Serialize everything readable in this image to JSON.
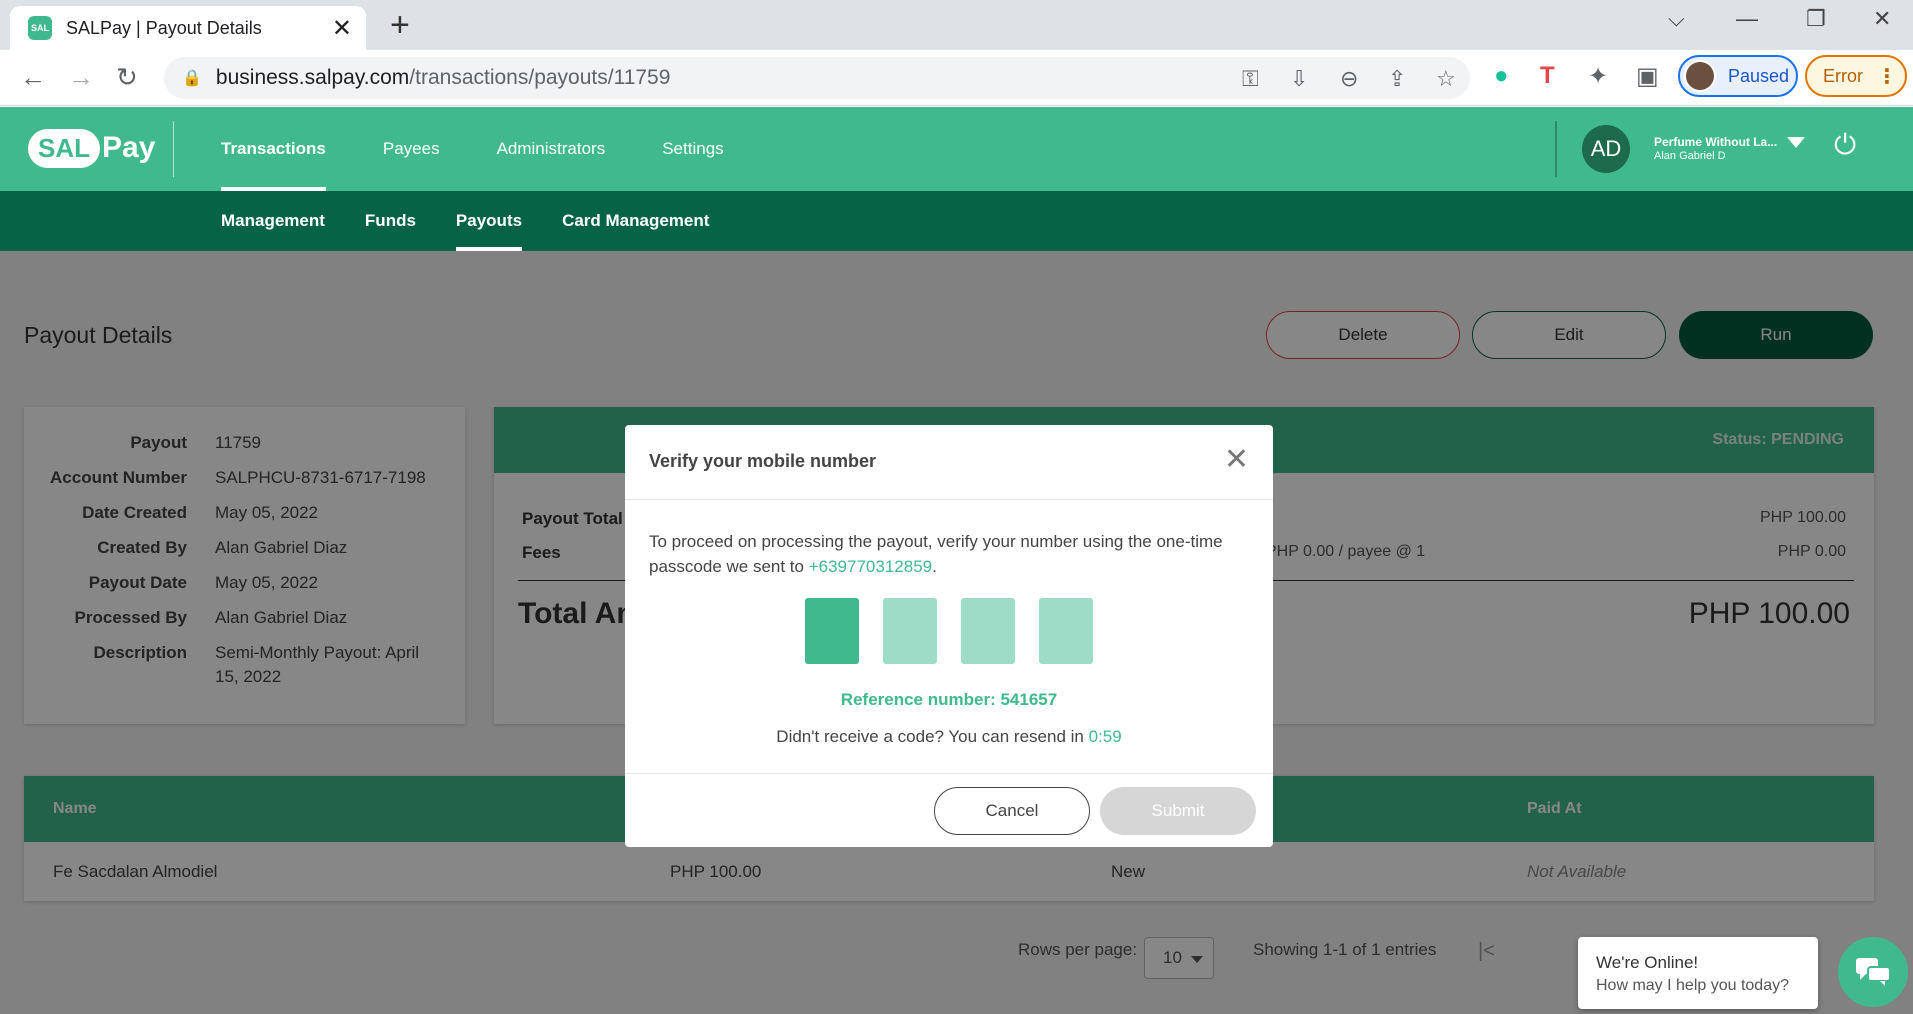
{
  "browser": {
    "tab_title": "SALPay | Payout Details",
    "favicon_text": "SAL",
    "url_host": "business.salpay.com",
    "url_path": "/transactions/payouts/11759",
    "profile_label": "Paused",
    "error_label": "Error"
  },
  "header": {
    "logo_sal": "SAL",
    "logo_pay": "Pay",
    "nav": [
      {
        "label": "Transactions",
        "active": true
      },
      {
        "label": "Payees"
      },
      {
        "label": "Administrators"
      },
      {
        "label": "Settings"
      }
    ],
    "user_initials": "AD",
    "user_org": "Perfume Without La...",
    "user_name": "Alan Gabriel D"
  },
  "subnav": [
    {
      "label": "Management"
    },
    {
      "label": "Funds"
    },
    {
      "label": "Payouts",
      "active": true
    },
    {
      "label": "Card Management"
    }
  ],
  "page": {
    "title": "Payout Details",
    "delete_label": "Delete",
    "edit_label": "Edit",
    "run_label": "Run"
  },
  "details": [
    {
      "label": "Payout",
      "value": "11759"
    },
    {
      "label": "Account Number",
      "value": "SALPHCU-8731-6717-7198"
    },
    {
      "label": "Date Created",
      "value": "May 05, 2022"
    },
    {
      "label": "Created By",
      "value": "Alan Gabriel Diaz"
    },
    {
      "label": "Payout Date",
      "value": "May 05, 2022"
    },
    {
      "label": "Processed By",
      "value": "Alan Gabriel Diaz"
    },
    {
      "label": "Description",
      "value": "Semi-Monthly Payout: April 15, 2022"
    }
  ],
  "summary": {
    "status": "Status: PENDING",
    "payout_total_label": "Payout Total",
    "payout_total_value": "PHP 100.00",
    "fees_label": "Fees",
    "fees_detail": "PHP 0.00 / payee @ 1",
    "fees_value": "PHP 0.00",
    "total_label": "Total Am",
    "total_value": "PHP 100.00"
  },
  "table": {
    "headers": [
      "Name",
      "Paid At"
    ],
    "row": {
      "name": "Fe Sacdalan Almodiel",
      "amount": "PHP 100.00",
      "status": "New",
      "paid_at": "Not Available"
    }
  },
  "pagination": {
    "rows_label": "Rows per page:",
    "rows_value": "10",
    "showing": "Showing 1-1 of 1 entries"
  },
  "modal": {
    "title": "Verify your mobile number",
    "text_before": "To proceed on processing the payout, verify your number using the one-time passcode we sent to ",
    "phone": "+639770312859",
    "text_after": ".",
    "reference": "Reference number: 541657",
    "resend_text": "Didn't receive a code? You can resend in ",
    "timer": "0:59",
    "cancel_label": "Cancel",
    "submit_label": "Submit"
  },
  "chat": {
    "line1": "We're Online!",
    "line2": "How may I help you today?"
  },
  "colors": {
    "brand": "#40b98e",
    "brand_dark": "#066346",
    "danger": "#e2454a"
  }
}
